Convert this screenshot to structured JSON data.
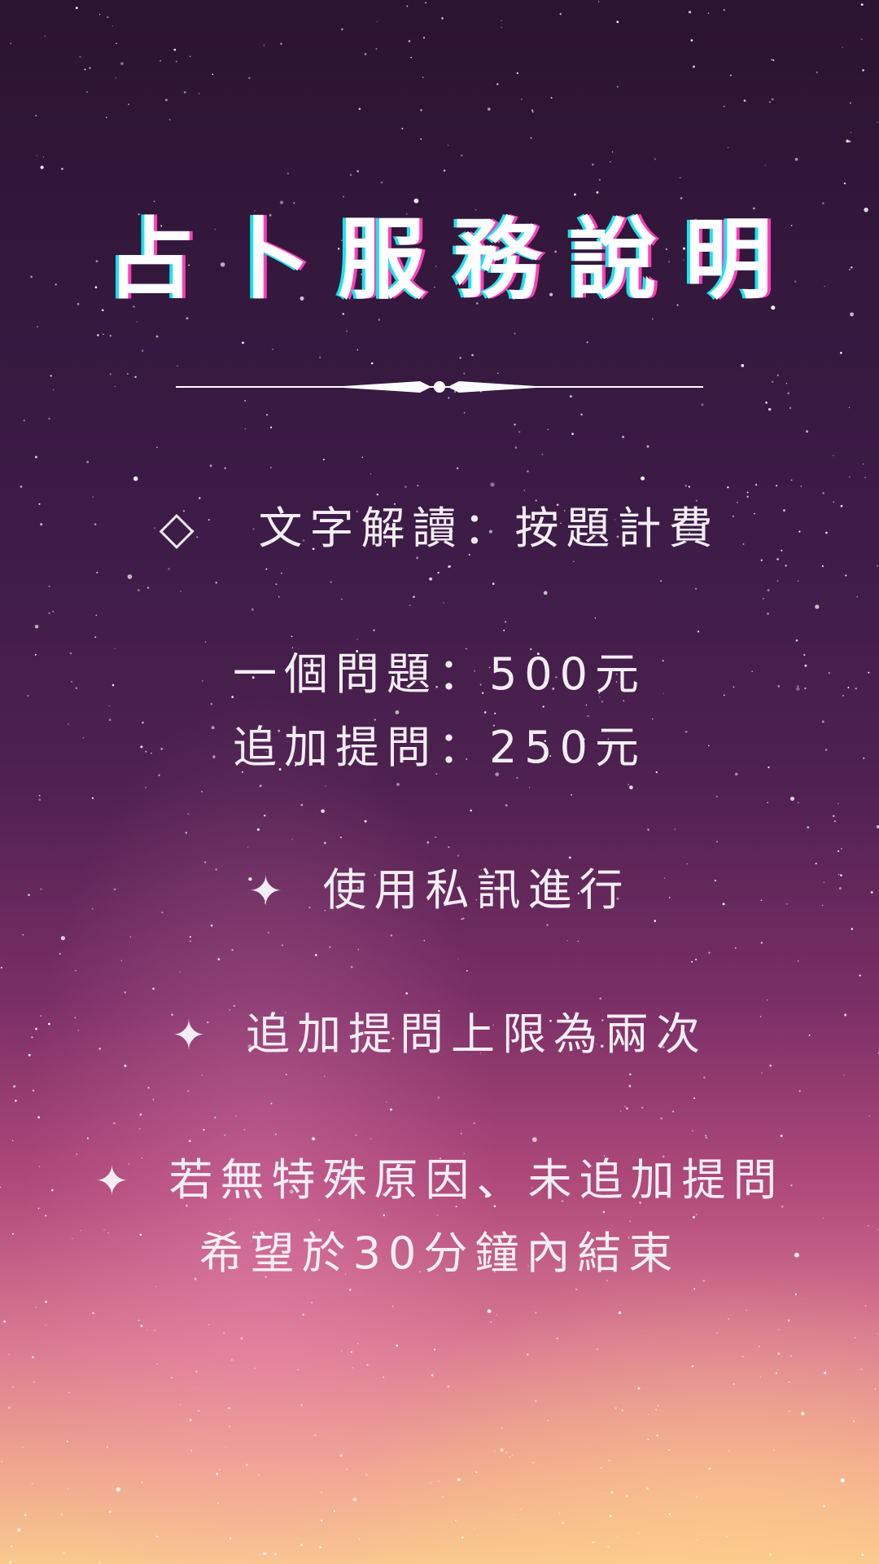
{
  "title": "占卜服務說明",
  "items": [
    {
      "marker": "◇",
      "text": "文字解讀：按題計費"
    },
    {
      "marker": "",
      "text": "一個問題：500元"
    },
    {
      "marker": "",
      "text": "追加提問：250元"
    },
    {
      "marker": "✦",
      "text": "使用私訊進行"
    },
    {
      "marker": "✦",
      "text": "追加提問上限為兩次"
    },
    {
      "marker": "✦",
      "text": "若無特殊原因、未追加提問"
    },
    {
      "marker": "",
      "text": "希望於30分鐘內結束"
    }
  ],
  "colors": {
    "title_shadow_left": "#19e3f0",
    "title_shadow_right": "#ff3fb8",
    "text": "#f4eef4"
  }
}
